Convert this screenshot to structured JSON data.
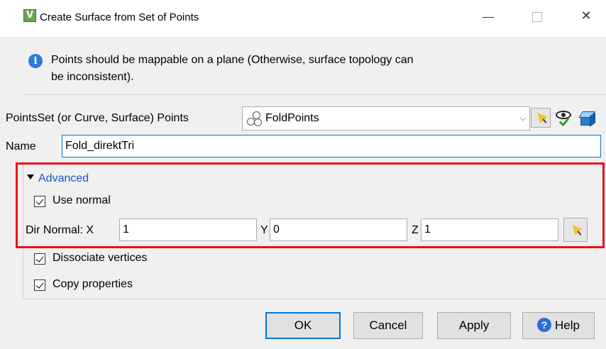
{
  "window": {
    "title": "Create Surface from Set of Points",
    "close_glyph": "✕"
  },
  "info": {
    "icon": "info-icon",
    "text": "Points should be mappable on a plane (Otherwise, surface topology can be inconsistent)."
  },
  "points": {
    "label": "PointsSet (or Curve, Surface) Points",
    "value": "FoldPoints",
    "arrow": "⌵"
  },
  "name": {
    "label": "Name",
    "value": "Fold_direktTri"
  },
  "advanced": {
    "label": "Advanced",
    "use_normal": {
      "label": "Use normal",
      "checked": true
    },
    "dir_normal": {
      "label": "Dir Normal: X",
      "x": "1",
      "y_label": "Y",
      "y": "0",
      "z_label": "Z",
      "z": "1"
    }
  },
  "options": {
    "dissociate": {
      "label": "Dissociate vertices",
      "checked": true
    },
    "copy_props": {
      "label": "Copy properties",
      "checked": true
    }
  },
  "buttons": {
    "ok": "OK",
    "cancel": "Cancel",
    "apply": "Apply",
    "help": "Help",
    "help_icon_glyph": "?"
  },
  "colors": {
    "highlight": "#e8101a",
    "link": "#1a56c8",
    "focus": "#0078d7"
  }
}
